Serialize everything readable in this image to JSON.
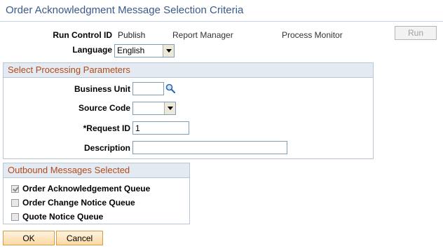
{
  "page": {
    "title": "Order Acknowledgment Message Selection Criteria"
  },
  "run_control": {
    "label": "Run Control ID",
    "value": "Publish",
    "report_manager_link": "Report Manager",
    "process_monitor_link": "Process Monitor",
    "run_button": "Run"
  },
  "language": {
    "label": "Language",
    "selected": "English"
  },
  "processing": {
    "header": "Select Processing Parameters",
    "business_unit": {
      "label": "Business Unit",
      "value": ""
    },
    "source_code": {
      "label": "Source Code",
      "selected": ""
    },
    "request_id": {
      "label": "*Request ID",
      "value": "1"
    },
    "description": {
      "label": "Description",
      "value": ""
    }
  },
  "outbound": {
    "header": "Outbound Messages Selected",
    "items": [
      {
        "label": "Order Acknowledgement Queue",
        "checked": true
      },
      {
        "label": "Order Change Notice Queue",
        "checked": false
      },
      {
        "label": "Quote Notice Queue",
        "checked": false
      }
    ]
  },
  "buttons": {
    "ok": "OK",
    "cancel": "Cancel"
  },
  "colors": {
    "title": "#3a5a8c",
    "group_header_text": "#b44a1a",
    "group_header_bg": "#e3eaf2",
    "button_border": "#d89a4b"
  },
  "icons": {
    "lookup": "magnifier-icon",
    "dropdown": "chevron-down-icon"
  }
}
